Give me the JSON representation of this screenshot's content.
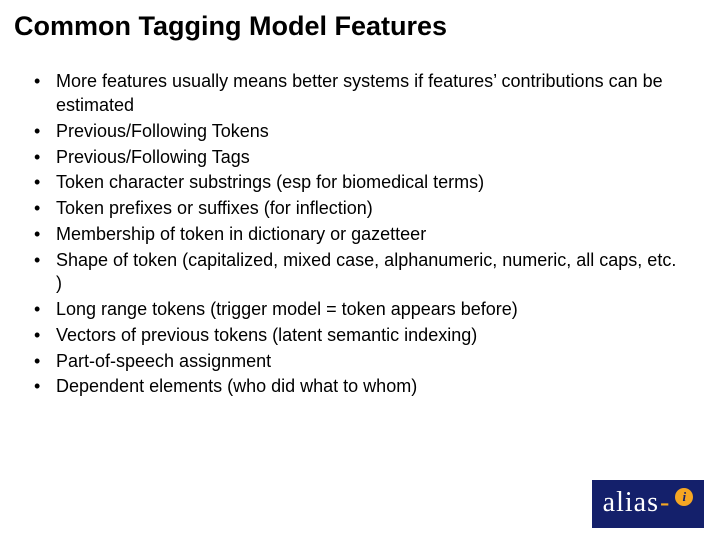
{
  "title": "Common Tagging Model Features",
  "bullets": [
    "More features usually means better systems if features’ contributions can be estimated",
    "Previous/Following Tokens",
    "Previous/Following Tags",
    "Token character substrings (esp for biomedical terms)",
    "Token prefixes or suffixes (for inflection)",
    "Membership of token in dictionary or gazetteer",
    "Shape of token (capitalized, mixed case, alphanumeric, numeric, all caps, etc. )",
    "Long range tokens (trigger model = token appears before)",
    "Vectors of previous tokens (latent semantic indexing)",
    "Part-of-speech assignment",
    "Dependent elements (who did what to whom)"
  ],
  "logo": {
    "text_left": "alias",
    "hyphen": "-",
    "dot_char": "i"
  }
}
